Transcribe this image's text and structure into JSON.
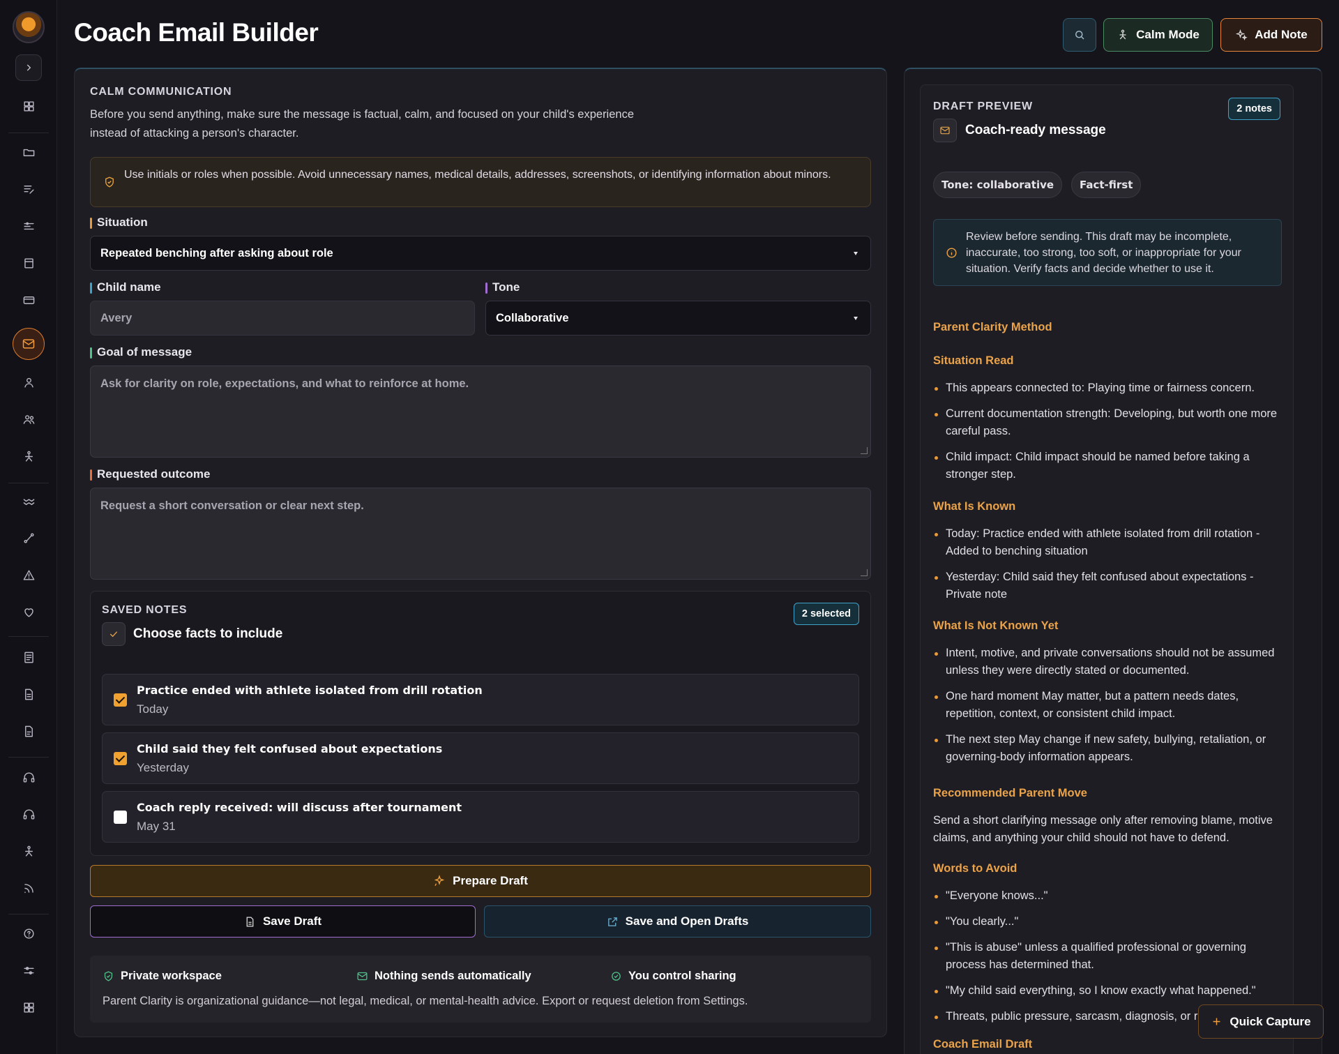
{
  "header": {
    "title": "Coach Email Builder",
    "calm_mode_label": "Calm Mode",
    "add_note_label": "Add Note"
  },
  "builder": {
    "section_label": "CALM COMMUNICATION",
    "intro": "Before you send anything, make sure the message is factual, calm, and focused on your child's experience instead of attacking a person's character.",
    "privacy_notice": "Use initials or roles when possible. Avoid unnecessary names, medical details, addresses, screenshots, or identifying information about minors.",
    "situation_label": "Situation",
    "situation_value": "Repeated benching after asking about role",
    "child_name_label": "Child name",
    "child_name_value": "Avery",
    "tone_label": "Tone",
    "tone_value": "Collaborative",
    "goal_label": "Goal of message",
    "goal_placeholder": "Ask for clarity on role, expectations, and what to reinforce at home.",
    "outcome_label": "Requested outcome",
    "outcome_placeholder": "Request a short conversation or clear next step."
  },
  "saved_notes": {
    "section_label": "SAVED NOTES",
    "heading": "Choose facts to include",
    "selected_badge": "2 selected",
    "items": [
      {
        "title": "Practice ended with athlete isolated from drill rotation",
        "date": "Today",
        "checked": true
      },
      {
        "title": "Child said they felt confused about expectations",
        "date": "Yesterday",
        "checked": true
      },
      {
        "title": "Coach reply received: will discuss after tournament",
        "date": "May 31",
        "checked": false
      }
    ]
  },
  "actions": {
    "prepare_label": "Prepare Draft",
    "save_label": "Save Draft",
    "save_open_label": "Save and Open Drafts"
  },
  "footer": {
    "private_label": "Private workspace",
    "nothing_sends_label": "Nothing sends automatically",
    "control_label": "You control sharing",
    "disclaimer": "Parent Clarity is organizational guidance—not legal, medical, or mental-health advice. Export or request deletion from Settings."
  },
  "preview": {
    "section_label": "DRAFT PREVIEW",
    "notes_badge": "2 notes",
    "heading": "Coach-ready message",
    "tone_pill": "Tone: collaborative",
    "fact_pill": "Fact-first",
    "review_notice": "Review before sending. This draft may be incomplete, inaccurate, too strong, too soft, or inappropriate for your situation. Verify facts and decide whether to use it.",
    "method_heading": "Parent Clarity Method",
    "situation_heading": "Situation Read",
    "situation_items": [
      "This appears connected to: Playing time or fairness concern.",
      "Current documentation strength: Developing, but worth one more careful pass.",
      "Child impact: Child impact should be named before taking a stronger step."
    ],
    "known_heading": "What Is Known",
    "known_items": [
      "Today: Practice ended with athlete isolated from drill rotation - Added to benching situation",
      "Yesterday: Child said they felt confused about expectations - Private note"
    ],
    "not_known_heading": "What Is Not Known Yet",
    "not_known_items": [
      "Intent, motive, and private conversations should not be assumed unless they were directly stated or documented.",
      "One hard moment May matter, but a pattern needs dates, repetition, context, or consistent child impact.",
      "The next step May change if new safety, bullying, retaliation, or governing-body information appears."
    ],
    "recommended_heading": "Recommended Parent Move",
    "recommended_text": "Send a short clarifying message only after removing blame, motive claims, and anything your child should not have to defend.",
    "avoid_heading": "Words to Avoid",
    "avoid_items": [
      "\"Everyone knows...\"",
      "\"You clearly...\"",
      "\"This is abuse\" unless a qualified professional or governing process has determined that.",
      "\"My child said everything, so I know exactly what happened.\"",
      "Threats, public pressure, sarcasm, diagnosis, or r"
    ],
    "email_draft_heading": "Coach Email Draft"
  },
  "quick_capture_label": "Quick Capture",
  "colors": {
    "accent_orange": "#e89a3a",
    "accent_blue": "#3fa3c9",
    "accent_green": "#4fc28a",
    "accent_purple": "#a06ed0"
  }
}
